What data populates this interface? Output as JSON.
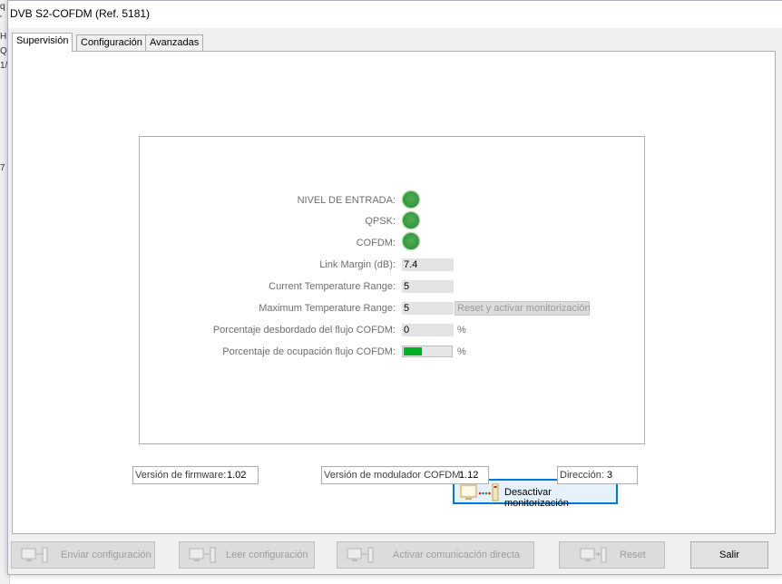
{
  "window": {
    "title": "DVB S2-COFDM (Ref. 5181)"
  },
  "background_fragments": [
    "q",
    "'",
    "H",
    "Q",
    "1/",
    "7"
  ],
  "tabs": [
    {
      "label": "Supervisión",
      "active": true
    },
    {
      "label": "Configuración",
      "active": false
    },
    {
      "label": "Avanzadas",
      "active": false
    }
  ],
  "status": {
    "nivel_label": "NIVEL DE ENTRADA:",
    "qpsk_label": "QPSK:",
    "cofdm_label": "COFDM:",
    "led_color": "#3b9c44"
  },
  "measurements": {
    "link_margin_label": "Link Margin (dB):",
    "link_margin_value": "7.4",
    "current_temp_label": "Current Temperature Range:",
    "current_temp_value": "5",
    "max_temp_label": "Maximum Temperature Range:",
    "max_temp_value": "5",
    "reset_label": "Reset y activar monitorización",
    "overflow_label": "Porcentaje desbordado del flujo COFDM:",
    "overflow_value": "0",
    "overflow_unit": "%",
    "occupancy_label": "Porcentaje de ocupación flujo COFDM:",
    "occupancy_fraction": 0.38,
    "occupancy_unit": "%",
    "progress_color": "#06b025"
  },
  "monitor_button": {
    "label": "Desactivar monitorización",
    "icon": "monitor-link-icon"
  },
  "info": {
    "firmware_label": "Versión de firmware:",
    "firmware_value": "1.02",
    "modulator_label": "Versión de modulador COFDM:",
    "modulator_value": "1.12",
    "address_label": "Dirección:",
    "address_value": "3"
  },
  "buttons": {
    "send": "Enviar configuración",
    "read": "Leer configuración",
    "direct": "Activar comunicación directa",
    "reset": "Reset",
    "exit": "Salir"
  }
}
